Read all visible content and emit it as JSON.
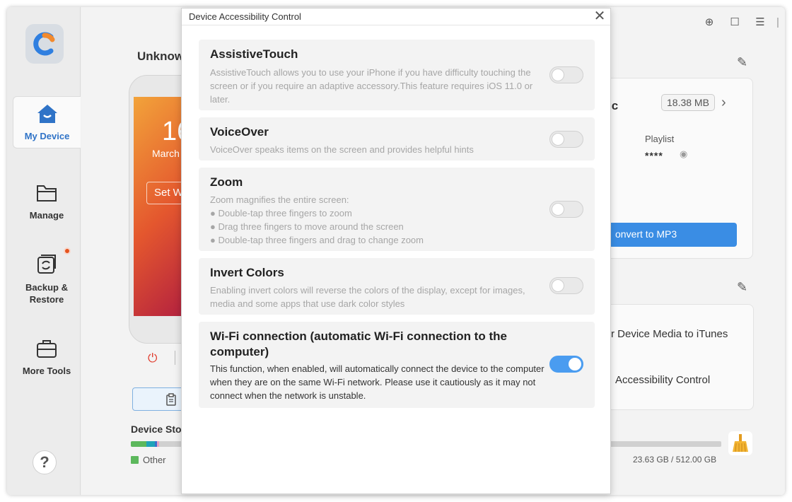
{
  "sidebar": {
    "items": [
      {
        "label": "My Device"
      },
      {
        "label": "Manage"
      },
      {
        "label": "Backup &\nRestore"
      },
      {
        "label": "More Tools"
      }
    ],
    "help": "?"
  },
  "device": {
    "name": "Unknow",
    "time": "16",
    "date": "March",
    "set_btn": "Set W"
  },
  "storage": {
    "title": "Device Stor",
    "legend_other": "Other",
    "value": "23.63 GB / 512.00 GB"
  },
  "music_card": {
    "title_fragment": "ic",
    "size": "18.38 MB",
    "playlist_label": "Playlist",
    "playlist_value": "****",
    "convert_btn": "onvert to MP3"
  },
  "tools_card": {
    "line1": "r Device Media to iTunes",
    "line2": "Accessibility Control"
  },
  "dialog": {
    "title": "Device Accessibility Control",
    "close": "✕",
    "items": [
      {
        "title": "AssistiveTouch",
        "desc": "AssistiveTouch allows you to use your iPhone if you have difficulty touching the screen or if you require an adaptive accessory.This feature requires iOS 11.0 or later.",
        "enabled": false
      },
      {
        "title": "VoiceOver",
        "desc": "VoiceOver speaks items on the screen and provides helpful hints",
        "enabled": false
      },
      {
        "title": "Zoom",
        "desc_lines": [
          "Zoom magnifies the entire screen:",
          "● Double-tap three fingers to zoom",
          "● Drag three fingers to move around the screen",
          "● Double-tap three fingers and drag to change zoom"
        ],
        "enabled": false
      },
      {
        "title": "Invert Colors",
        "desc": "Enabling invert colors will reverse the colors of the display, except for images, media and some apps that use dark color styles",
        "enabled": false
      },
      {
        "title": "Wi-Fi connection (automatic Wi-Fi connection to the computer)",
        "desc": "This function, when enabled, will automatically connect the device to the computer when they are on the same Wi-Fi network. Please use it cautiously as it may not connect when the network is unstable.",
        "enabled": true
      }
    ]
  },
  "colors": {
    "accent": "#3a8de4",
    "toggle_on": "#4a9cf0",
    "badge": "#e5531e"
  }
}
